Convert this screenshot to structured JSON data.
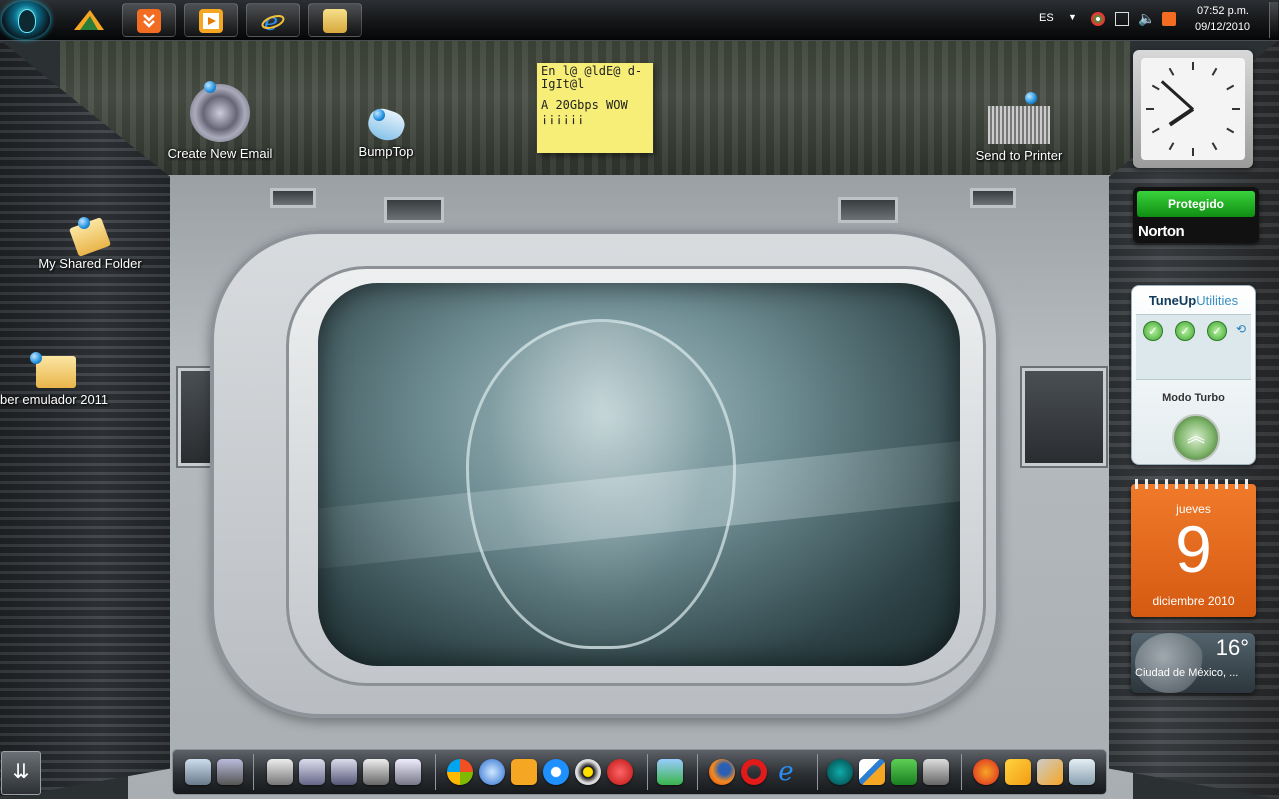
{
  "taskbar_top": {
    "pinned": [
      {
        "name": "alienware-start-orb"
      },
      {
        "name": "winamp-icon"
      },
      {
        "name": "download-manager-icon",
        "color": "#f26d21"
      },
      {
        "name": "media-player-icon",
        "color": "#f5a623"
      },
      {
        "name": "internet-explorer-icon",
        "color": "#1e88e5"
      },
      {
        "name": "file-explorer-icon",
        "color": "#e8c35a"
      }
    ],
    "tray": {
      "language": "ES",
      "time": "07:52 p.m.",
      "date": "09/12/2010"
    }
  },
  "desktop": {
    "icons": [
      {
        "label": "Create New Email"
      },
      {
        "label": "BumpTop"
      },
      {
        "label": "Send to Printer"
      },
      {
        "label": "My Shared Folder"
      },
      {
        "label": "ber emulador 2011"
      }
    ],
    "sticky_note": {
      "line1": "En l@ @ldE@ d-IgIt@l",
      "line2": "A 20Gbps WOW",
      "line3": "¡¡¡¡¡¡"
    }
  },
  "gadgets": {
    "clock": {
      "hour": 7,
      "minute": 52
    },
    "norton": {
      "status": "Protegido",
      "brand": "Norton",
      "status_color": "#22b024"
    },
    "tuneup": {
      "brand_main": "TuneUp",
      "brand_sub": "Utilities",
      "mode_label": "Modo Turbo",
      "checks": [
        "✓",
        "✓",
        "✓"
      ]
    },
    "calendar": {
      "weekday": "jueves",
      "day": "9",
      "month_year": "diciembre 2010",
      "color": "#e8671c"
    },
    "weather": {
      "temperature": "16°",
      "city": "Ciudad de México, ..."
    }
  },
  "dock": {
    "groups": [
      [
        "server-icon",
        "display-icon"
      ],
      [
        "alien-fx-icon",
        "alien-tools-icon",
        "alien-headset-icon",
        "alien-respawn-icon",
        "alien-settings-icon"
      ],
      [
        "windows-start-icon",
        "itunes-icon",
        "media-player-icon",
        "quicktime-icon",
        "eye-capture-icon",
        "power-icon"
      ],
      [
        "messenger-icon"
      ],
      [
        "firefox-icon",
        "opera-icon",
        "internet-explorer-icon"
      ],
      [
        "e-book-icon",
        "bump-icon",
        "excel-icon",
        "vmware-icon"
      ],
      [
        "crash-icon",
        "playstation-icon",
        "tools-icon",
        "recycle-bin-icon"
      ]
    ]
  }
}
